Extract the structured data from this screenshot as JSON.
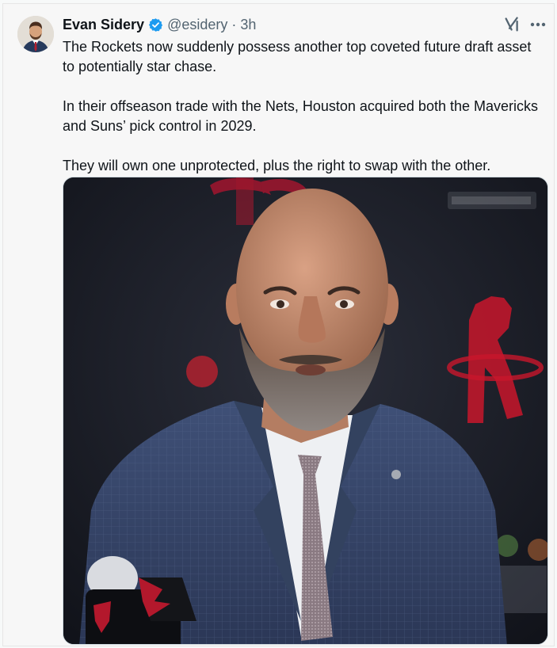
{
  "tweet": {
    "author": "Evan Sidery",
    "handle": "@esidery",
    "separator": "·",
    "time": "3h",
    "paragraphs": [
      "The Rockets now suddenly possess another top coveted future draft asset to potentially star chase.",
      "In their offseason trade with the Nets, Houston acquired both the Mavericks and Suns’ pick control in 2029.",
      "They will own one unprotected, plus the right to swap with the other."
    ]
  },
  "icons": {
    "verified": "verified-badge-icon",
    "grok": "grok-icon",
    "more": "more-options-icon"
  },
  "colors": {
    "verified_blue": "#1d9bf0",
    "text_primary": "#0f1419",
    "text_secondary": "#536471",
    "rockets_red": "#ce1141"
  }
}
